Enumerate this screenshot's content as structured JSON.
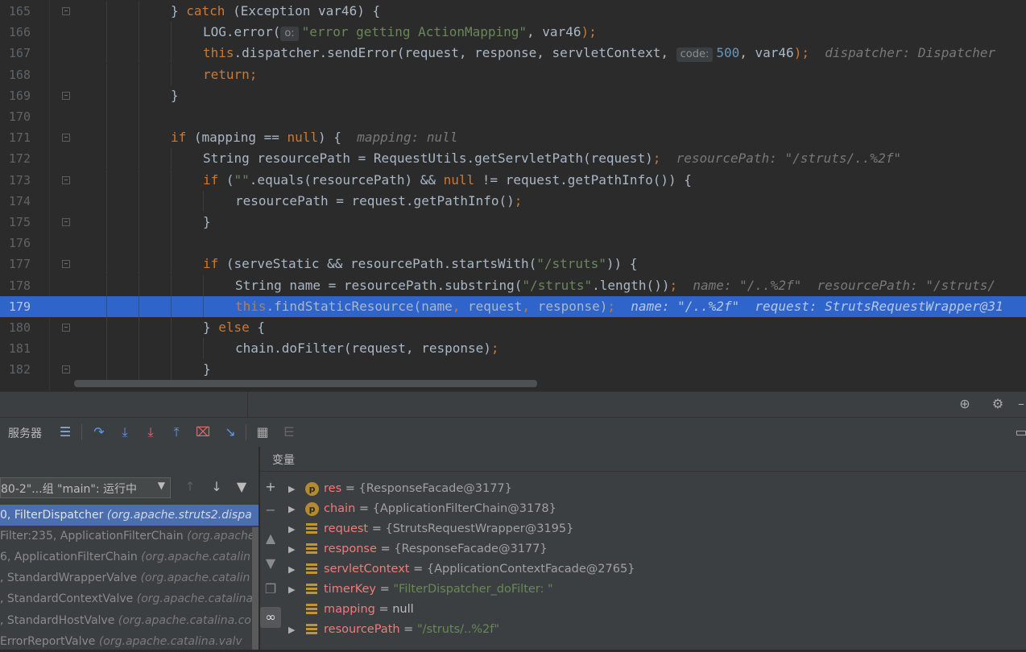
{
  "editor": {
    "lines": [
      {
        "n": "165",
        "indent": 212,
        "segs": [
          [
            "plain",
            "} "
          ],
          [
            "kw",
            "catch"
          ],
          [
            "plain",
            " (Exception var46) {"
          ]
        ]
      },
      {
        "n": "166",
        "indent": 252,
        "segs": [
          [
            "plain",
            "LOG.error("
          ],
          [
            "pill",
            "o:"
          ],
          [
            "str",
            "\"error getting ActionMapping\""
          ],
          [
            "plain",
            ", var46"
          ],
          [
            "kw",
            ")"
          ],
          [
            "kw",
            ";"
          ]
        ]
      },
      {
        "n": "167",
        "indent": 252,
        "segs": [
          [
            "kw",
            "this"
          ],
          [
            "plain",
            ".dispatcher.sendError(request, response, servletContext, "
          ],
          [
            "pill",
            "code:"
          ],
          [
            "num",
            "500"
          ],
          [
            "plain",
            ", var46"
          ],
          [
            "kw",
            ")"
          ],
          [
            "kw",
            ";"
          ],
          [
            "hint",
            "  dispatcher: Dispatcher"
          ]
        ]
      },
      {
        "n": "168",
        "indent": 252,
        "segs": [
          [
            "kw",
            "return;"
          ]
        ]
      },
      {
        "n": "169",
        "indent": 212,
        "segs": [
          [
            "plain",
            "}"
          ]
        ]
      },
      {
        "n": "170",
        "indent": 212,
        "segs": []
      },
      {
        "n": "171",
        "indent": 212,
        "segs": [
          [
            "kw",
            "if"
          ],
          [
            "plain",
            " (mapping == "
          ],
          [
            "kw",
            "null"
          ],
          [
            "plain",
            ") {  "
          ],
          [
            "hint",
            "mapping: null"
          ]
        ]
      },
      {
        "n": "172",
        "indent": 252,
        "segs": [
          [
            "plain",
            "String resourcePath = RequestUtils.getServletPath(request)"
          ],
          [
            "kw",
            ";"
          ],
          [
            "hint",
            "  resourcePath: \"/struts/..%2f\""
          ]
        ]
      },
      {
        "n": "173",
        "indent": 252,
        "segs": [
          [
            "kw",
            "if"
          ],
          [
            "plain",
            " ("
          ],
          [
            "str",
            "\"\""
          ],
          [
            "plain",
            ".equals(resourcePath) && "
          ],
          [
            "kw",
            "null"
          ],
          [
            "plain",
            " != request.getPathInfo()) {"
          ]
        ]
      },
      {
        "n": "174",
        "indent": 292,
        "segs": [
          [
            "plain",
            "resourcePath = request.getPathInfo()"
          ],
          [
            "kw",
            ";"
          ]
        ]
      },
      {
        "n": "175",
        "indent": 252,
        "segs": [
          [
            "plain",
            "}"
          ]
        ]
      },
      {
        "n": "176",
        "indent": 252,
        "segs": []
      },
      {
        "n": "177",
        "indent": 252,
        "segs": [
          [
            "kw",
            "if"
          ],
          [
            "plain",
            " (serveStatic && resourcePath.startsWith("
          ],
          [
            "str",
            "\"/struts\""
          ],
          [
            "plain",
            ")) {"
          ]
        ]
      },
      {
        "n": "178",
        "indent": 292,
        "segs": [
          [
            "plain",
            "String name = resourcePath.substring("
          ],
          [
            "str",
            "\"/struts\""
          ],
          [
            "plain",
            ".length())"
          ],
          [
            "kw",
            ";"
          ],
          [
            "hint",
            "  name: \"/..%2f\"  resourcePath: \"/struts/"
          ]
        ]
      },
      {
        "n": "179",
        "indent": 292,
        "exec": true,
        "segs": [
          [
            "kw",
            "this"
          ],
          [
            "plain",
            ".findStaticResource(name"
          ],
          [
            "kw",
            ","
          ],
          [
            "plain",
            " request"
          ],
          [
            "kw",
            ","
          ],
          [
            "plain",
            " response)"
          ],
          [
            "kw",
            ";"
          ],
          [
            "hint",
            "  name: \"/..%2f\"  request: StrutsRequestWrapper@31"
          ]
        ]
      },
      {
        "n": "180",
        "indent": 252,
        "segs": [
          [
            "plain",
            "} "
          ],
          [
            "kw",
            "else"
          ],
          [
            "plain",
            " {"
          ]
        ]
      },
      {
        "n": "181",
        "indent": 292,
        "segs": [
          [
            "plain",
            "chain.doFilter(request, response)"
          ],
          [
            "kw",
            ";"
          ]
        ]
      },
      {
        "n": "182",
        "indent": 252,
        "segs": [
          [
            "plain",
            "}"
          ]
        ]
      }
    ]
  },
  "debug": {
    "server_tab": "服务器",
    "variables_title": "变量",
    "thread_select": "80-2\"...组 \"main\": 运行中",
    "frames": [
      {
        "text": "0, FilterDispatcher ",
        "pkg": "(org.apache.struts2.dispa",
        "selected": true
      },
      {
        "text": "Filter:235, ApplicationFilterChain ",
        "pkg": "(org.apache"
      },
      {
        "text": "6, ApplicationFilterChain ",
        "pkg": "(org.apache.catalin"
      },
      {
        "text": ", StandardWrapperValve ",
        "pkg": "(org.apache.catalin"
      },
      {
        "text": ", StandardContextValve ",
        "pkg": "(org.apache.catalina"
      },
      {
        "text": ", StandardHostValve ",
        "pkg": "(org.apache.catalina.co"
      },
      {
        "text": "ErrorReportValve ",
        "pkg": "(org.apache.catalina.valv"
      }
    ],
    "variables": [
      {
        "badge": "p",
        "name": "res",
        "value": "{ResponseFacade@3177}",
        "expand": true
      },
      {
        "badge": "p",
        "name": "chain",
        "value": "{ApplicationFilterChain@3178}",
        "expand": true
      },
      {
        "badge": "f",
        "name": "request",
        "value": "{StrutsRequestWrapper@3195}",
        "expand": true
      },
      {
        "badge": "f",
        "name": "response",
        "value": "{ResponseFacade@3177}",
        "expand": true
      },
      {
        "badge": "f",
        "name": "servletContext",
        "value": "{ApplicationContextFacade@2765}",
        "expand": true
      },
      {
        "badge": "f",
        "name": "timerKey",
        "value": "\"FilterDispatcher_doFilter: \"",
        "expand": true,
        "str": true
      },
      {
        "badge": "f",
        "name": "mapping",
        "value": "null",
        "expand": false
      },
      {
        "badge": "f",
        "name": "resourcePath",
        "value": "\"/struts/..%2f\"",
        "expand": true,
        "str": true
      }
    ],
    "icons": [
      "crosshair-icon",
      "gear-icon",
      "minimize-icon"
    ]
  }
}
